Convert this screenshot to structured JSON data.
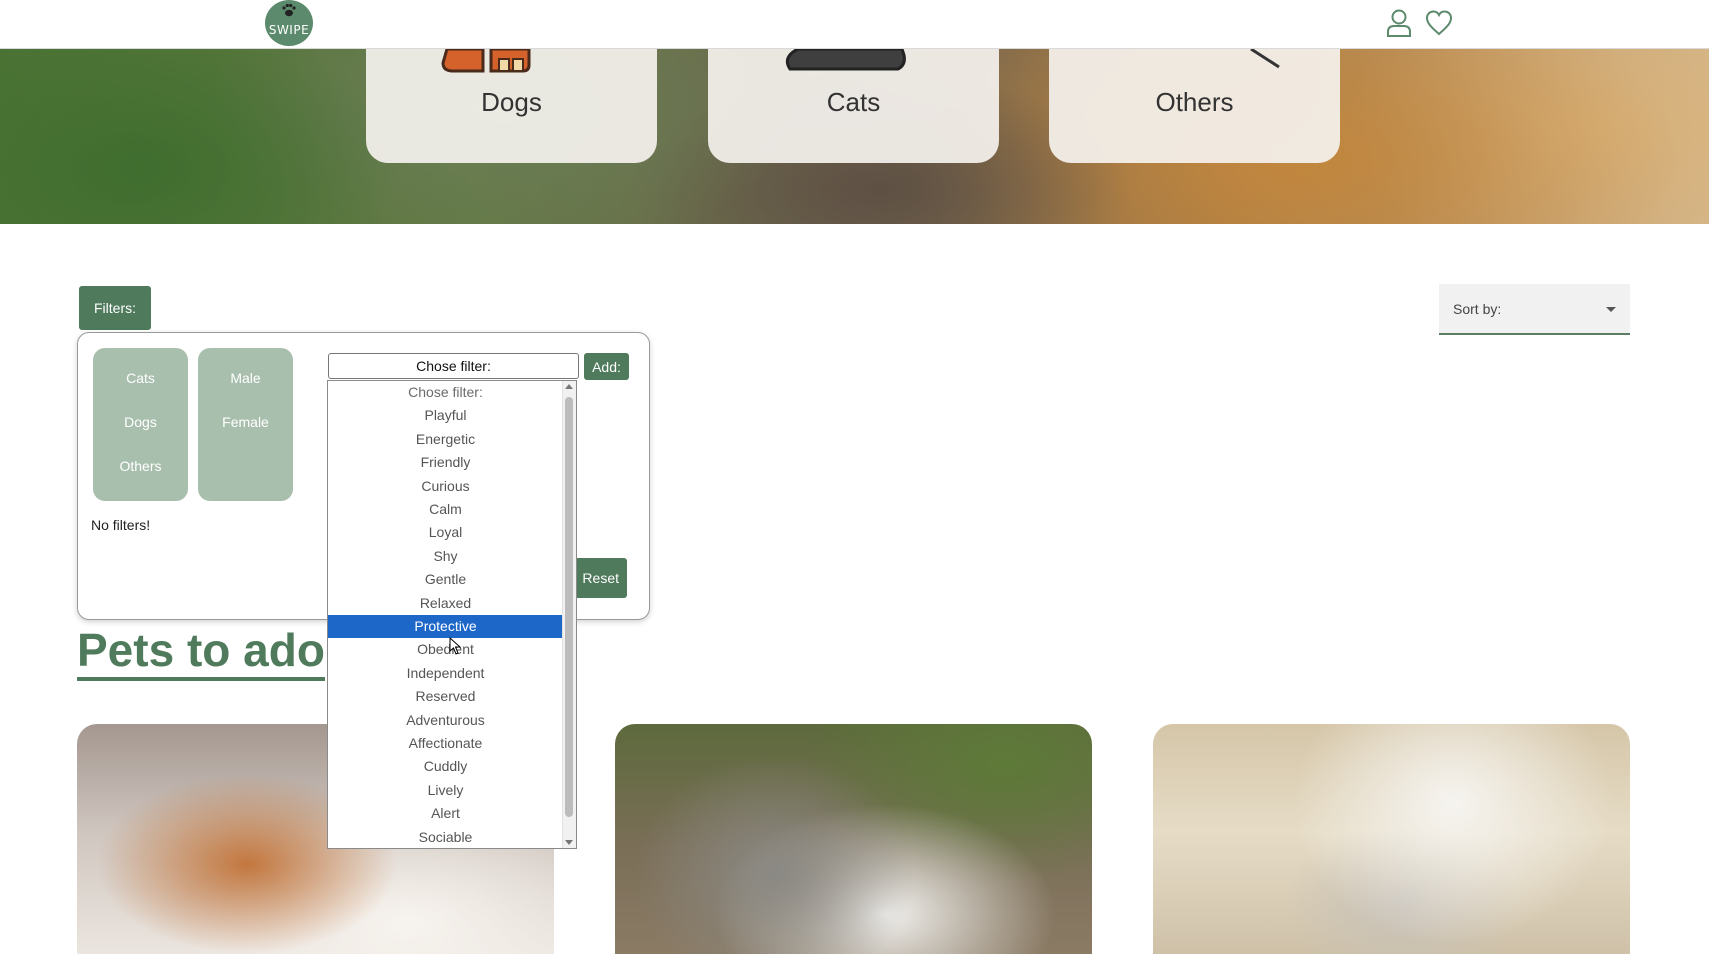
{
  "header": {
    "logo_text": "SWIPE",
    "icons": [
      "user-icon",
      "heart-icon"
    ]
  },
  "hero": {
    "categories": [
      {
        "label": "Dogs"
      },
      {
        "label": "Cats"
      },
      {
        "label": "Others"
      }
    ]
  },
  "filters": {
    "button_label": "Filters:",
    "species": [
      "Cats",
      "Dogs",
      "Others"
    ],
    "sex": [
      "Male",
      "Female"
    ],
    "empty_text": "No filters!",
    "select_value": "Chose filter:",
    "add_label": "Add:",
    "reset_label": "Reset",
    "options": [
      "Chose filter:",
      "Playful",
      "Energetic",
      "Friendly",
      "Curious",
      "Calm",
      "Loyal",
      "Shy",
      "Gentle",
      "Relaxed",
      "Protective",
      "Obedient",
      "Independent",
      "Reserved",
      "Adventurous",
      "Affectionate",
      "Cuddly",
      "Lively",
      "Alert",
      "Sociable"
    ],
    "highlighted_option": "Protective"
  },
  "sort": {
    "label": "Sort by:"
  },
  "main": {
    "section_title": "Pets to ado"
  },
  "colors": {
    "accent": "#4f7a5c",
    "chip": "#a9bfae",
    "selection": "#1d67c8"
  }
}
